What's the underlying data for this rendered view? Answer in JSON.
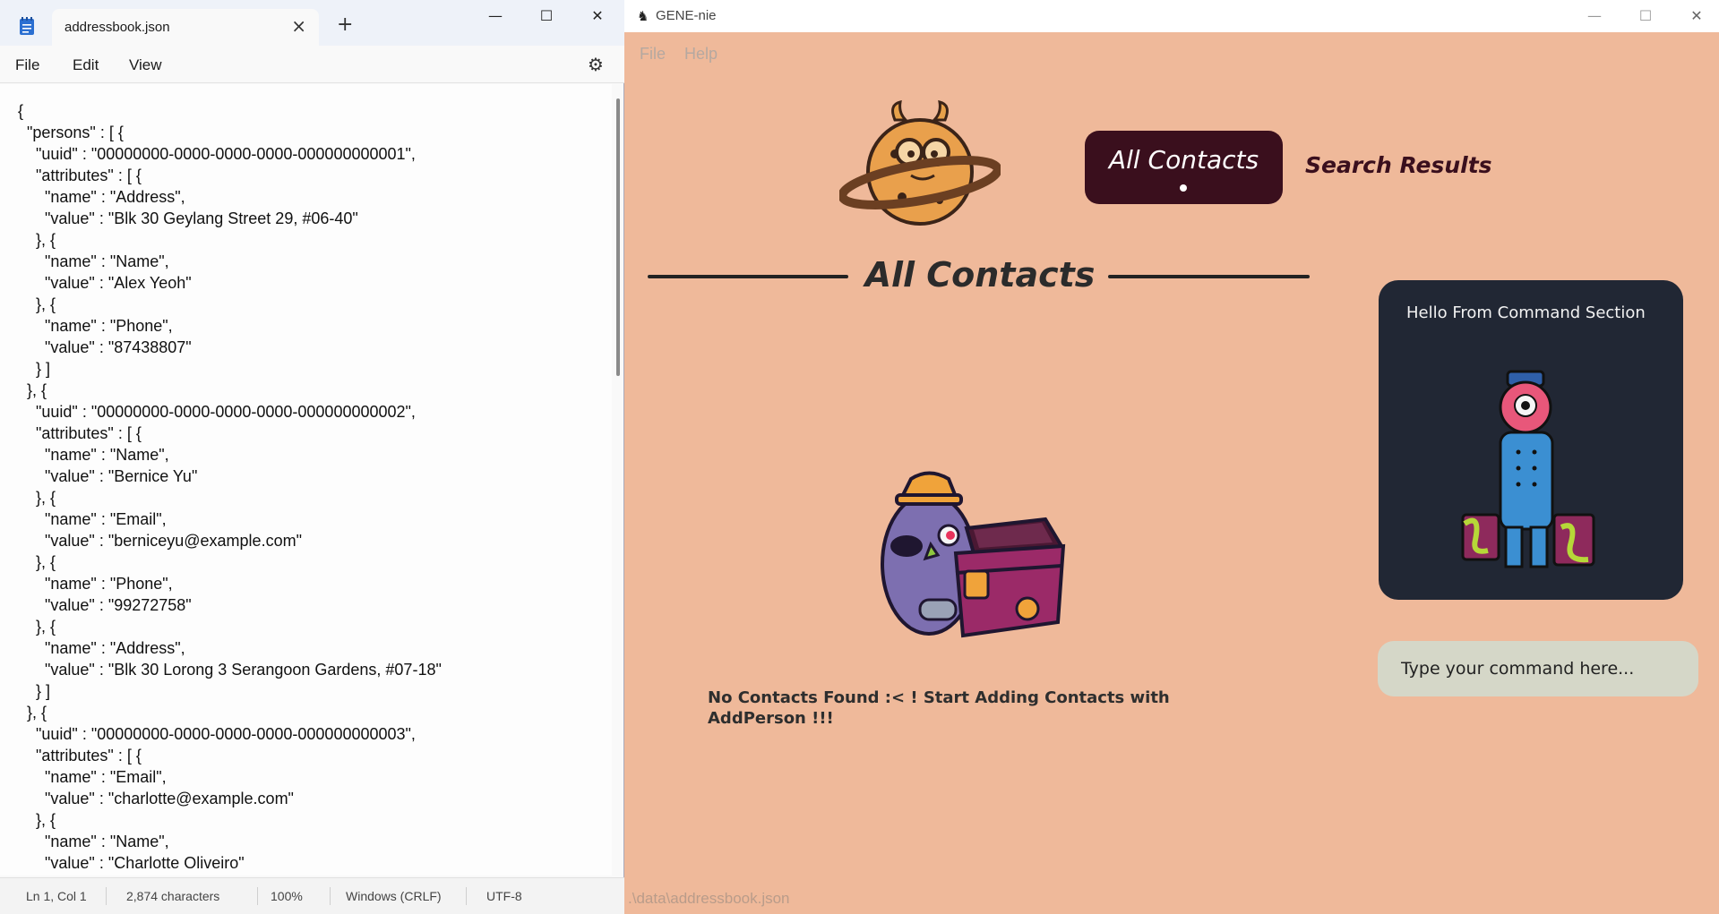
{
  "notepad": {
    "tab_title": "addressbook.json",
    "tab_close_icon": "×",
    "new_tab_icon": "+",
    "window_controls": {
      "minimize": "—",
      "maximize": "☐",
      "close": "✕"
    },
    "menu": {
      "file": "File",
      "edit": "Edit",
      "view": "View"
    },
    "settings_icon": "⚙",
    "content": "{\n  \"persons\" : [ {\n    \"uuid\" : \"00000000-0000-0000-0000-000000000001\",\n    \"attributes\" : [ {\n      \"name\" : \"Address\",\n      \"value\" : \"Blk 30 Geylang Street 29, #06-40\"\n    }, {\n      \"name\" : \"Name\",\n      \"value\" : \"Alex Yeoh\"\n    }, {\n      \"name\" : \"Phone\",\n      \"value\" : \"87438807\"\n    } ]\n  }, {\n    \"uuid\" : \"00000000-0000-0000-0000-000000000002\",\n    \"attributes\" : [ {\n      \"name\" : \"Name\",\n      \"value\" : \"Bernice Yu\"\n    }, {\n      \"name\" : \"Email\",\n      \"value\" : \"berniceyu@example.com\"\n    }, {\n      \"name\" : \"Phone\",\n      \"value\" : \"99272758\"\n    }, {\n      \"name\" : \"Address\",\n      \"value\" : \"Blk 30 Lorong 3 Serangoon Gardens, #07-18\"\n    } ]\n  }, {\n    \"uuid\" : \"00000000-0000-0000-0000-000000000003\",\n    \"attributes\" : [ {\n      \"name\" : \"Email\",\n      \"value\" : \"charlotte@example.com\"\n    }, {\n      \"name\" : \"Name\",\n      \"value\" : \"Charlotte Oliveiro\"",
    "status": {
      "position": "Ln 1, Col 1",
      "characters": "2,874 characters",
      "zoom": "100%",
      "line_ending": "Windows (CRLF)",
      "encoding": "UTF-8"
    }
  },
  "gene": {
    "title": "GENE-nie",
    "app_icon": "♞",
    "window_controls": {
      "minimize": "—",
      "maximize": "☐",
      "close": "✕"
    },
    "menu": {
      "file": "File",
      "help": "Help"
    },
    "nav": {
      "all_contacts": "All Contacts",
      "search_results": "Search Results"
    },
    "section_title": "All Contacts",
    "empty_message": "No Contacts Found :< ! Start Adding Contacts with AddPerson !!!",
    "command_panel": {
      "greeting": "Hello From Command Section"
    },
    "command_input": {
      "placeholder": "Type your command here...",
      "value": ""
    },
    "status_path": ".\\data\\addressbook.json",
    "colors": {
      "background": "#efb99a",
      "accent": "#3a0f1d",
      "panel": "#212734",
      "input": "#d5d7c8"
    }
  }
}
